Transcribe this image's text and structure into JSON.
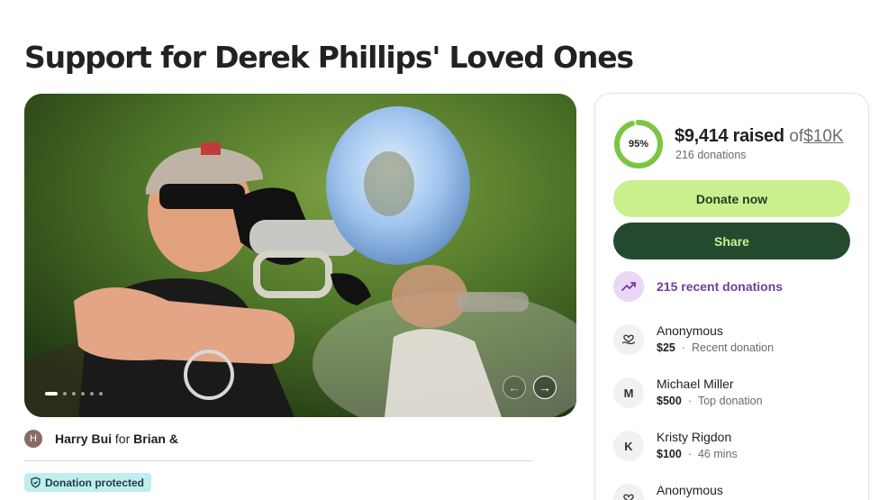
{
  "page": {
    "title": "Support for Derek Phillips' Loved Ones"
  },
  "hero": {
    "image_description_icon": "photo-trumpet-player",
    "carousel_count": 6,
    "carousel_active_index": 0
  },
  "organizer": {
    "avatar_initial": "H",
    "name": "Harry Bui",
    "for_word": "for",
    "beneficiary": "Brian &"
  },
  "protection": {
    "label": "Donation protected"
  },
  "fundraiser": {
    "progress_percent": 95,
    "progress_label": "95%",
    "raised": "$9,414 raised",
    "of_word": "of",
    "goal": "$10K",
    "donation_count": "216 donations",
    "donate_label": "Donate now",
    "share_label": "Share",
    "recent_label": "215 recent donations"
  },
  "donations": [
    {
      "avatar": "heart-hand-icon",
      "initial": "",
      "name": "Anonymous",
      "amount": "$25",
      "note": "Recent donation"
    },
    {
      "avatar": "initial",
      "initial": "M",
      "name": "Michael Miller",
      "amount": "$500",
      "note": "Top donation"
    },
    {
      "avatar": "initial",
      "initial": "K",
      "name": "Kristy Rigdon",
      "amount": "$100",
      "note": "46 mins"
    },
    {
      "avatar": "heart-hand-icon",
      "initial": "",
      "name": "Anonymous",
      "amount": "",
      "note": ""
    }
  ],
  "colors": {
    "donate_bg": "#c9f08d",
    "share_bg": "#234a2f",
    "progress": "#7cc544",
    "recent_accent": "#6a3f9c",
    "badge_bg": "#bfeeee"
  }
}
